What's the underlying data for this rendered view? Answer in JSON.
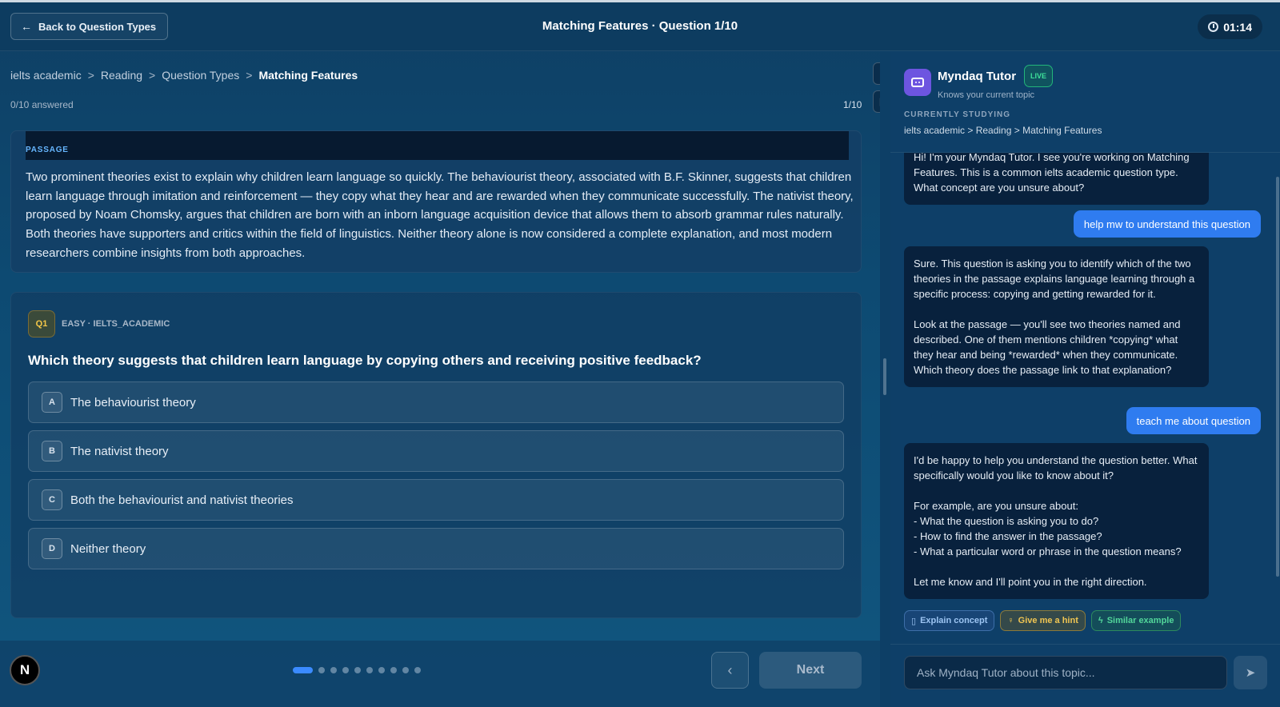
{
  "header": {
    "back_label": "Back to Question Types",
    "title": "Matching Features · Question 1/10",
    "timer": "01:14"
  },
  "breadcrumb": {
    "items": [
      "ielts academic",
      "Reading",
      "Question Types"
    ],
    "separator": ">",
    "current": "Matching Features"
  },
  "progress": {
    "answered_text": "0/10 answered",
    "counter": "1/10",
    "total_dots": 10,
    "current_index": 1
  },
  "passage": {
    "label": "PASSAGE",
    "text": "Two prominent theories exist to explain why children learn language so quickly. The behaviourist theory, associated with B.F. Skinner, suggests that children learn language through imitation and reinforcement — they copy what they hear and are rewarded when they communicate successfully. The nativist theory, proposed by Noam Chomsky, argues that children are born with an inborn language acquisition device that allows them to absorb grammar rules naturally. Both theories have supporters and critics within the field of linguistics. Neither theory alone is now considered a complete explanation, and most modern researchers combine insights from both approaches."
  },
  "question": {
    "badge": "Q1",
    "meta": "EASY · IELTS_ACADEMIC",
    "text": "Which theory suggests that children learn language by copying others and receiving positive feedback?",
    "options": [
      {
        "letter": "A",
        "text": "The behaviourist theory"
      },
      {
        "letter": "B",
        "text": "The nativist theory"
      },
      {
        "letter": "C",
        "text": "Both the behaviourist and nativist theories"
      },
      {
        "letter": "D",
        "text": "Neither theory"
      }
    ]
  },
  "footer": {
    "avatar_letter": "N",
    "prev_icon": "‹",
    "next_label": "Next"
  },
  "tutor": {
    "name": "Myndaq Tutor",
    "live_badge": "LIVE",
    "subtitle": "Knows your current topic",
    "studying_label": "CURRENTLY STUDYING",
    "studying_path": "ielts academic > Reading > Matching Features",
    "messages": [
      {
        "role": "bot",
        "text": "Hi! I'm your Myndaq Tutor. I see you're working on Matching Features. This is a common ielts academic question type. What concept are you unsure about?"
      },
      {
        "role": "user",
        "text": "help mw to understand this question"
      },
      {
        "role": "bot",
        "text": "Sure. This question is asking you to identify which of the two theories in the passage explains language learning through a specific process: copying and getting rewarded for it.\n\nLook at the passage — you'll see two theories named and described. One of them mentions children *copying* what they hear and being *rewarded* when they communicate. Which theory does the passage link to that explanation?"
      },
      {
        "role": "user",
        "text": "teach me about question"
      },
      {
        "role": "bot",
        "text": "I'd be happy to help you understand the question better. What specifically would you like to know about it?\n\nFor example, are you unsure about:\n- What the question is asking you to do?\n- How to find the answer in the passage?\n- What a particular word or phrase in the question means?\n\nLet me know and I'll point you in the right direction."
      }
    ],
    "chips": [
      "Explain concept",
      "Give me a hint",
      "Similar example"
    ],
    "input_placeholder": "Ask Myndaq Tutor about this topic..."
  }
}
